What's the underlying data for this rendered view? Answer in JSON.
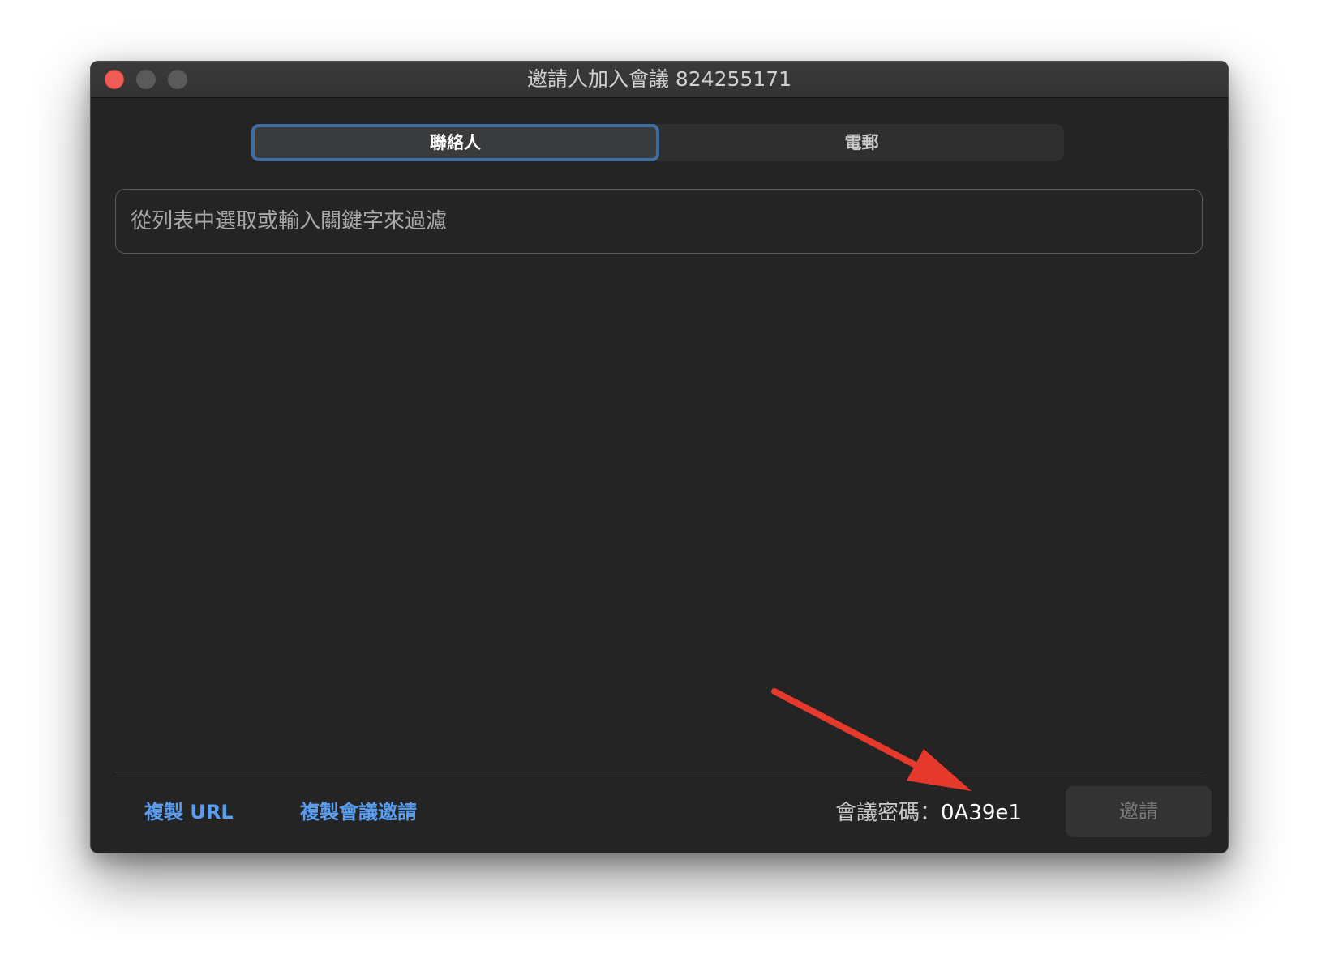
{
  "window": {
    "title": "邀請人加入會議 824255171"
  },
  "tabs": [
    {
      "label": "聯絡人",
      "selected": true
    },
    {
      "label": "電郵",
      "selected": false
    }
  ],
  "search": {
    "placeholder": "從列表中選取或輸入關鍵字來過濾",
    "value": ""
  },
  "footer": {
    "copy_url_label": "複製 URL",
    "copy_invitation_label": "複製會議邀請",
    "passcode_label": "會議密碼：",
    "passcode_value": "0A39e1",
    "invite_label": "邀請"
  },
  "colors": {
    "window_bg": "#242424",
    "link_blue": "#5b9ef0",
    "tab_focus": "#3f6ea3",
    "close_red": "#ee5c56",
    "annotation_arrow": "#e5392b"
  },
  "icons": {
    "traffic_lights": [
      "close-button",
      "minimize-button",
      "zoom-button"
    ],
    "annotation": "red-arrow-icon"
  }
}
